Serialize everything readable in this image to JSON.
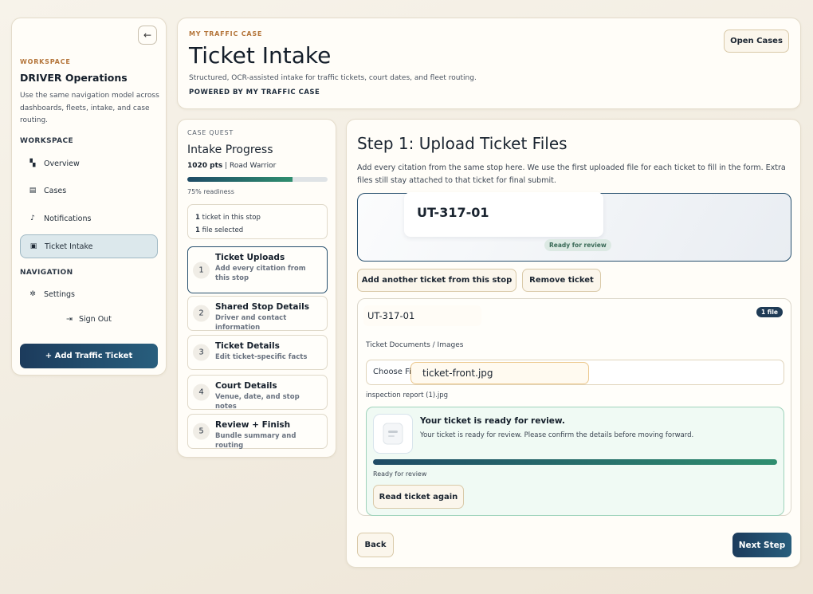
{
  "sidebar": {
    "collapse_icon": "←",
    "eyebrow": "WORKSPACE",
    "title": "DRIVER Operations",
    "description": "Use the same navigation model across dashboards, fleets, intake, and case routing.",
    "section_workspace": "WORKSPACE",
    "section_navigation": "NAVIGATION",
    "items": [
      {
        "label": "Overview",
        "icon": "dashboard-icon"
      },
      {
        "label": "Cases",
        "icon": "cases-icon"
      },
      {
        "label": "Notifications",
        "icon": "bell-icon"
      },
      {
        "label": "Ticket Intake",
        "icon": "ticket-icon",
        "active": true
      }
    ],
    "settings_label": "Settings",
    "signout_label": "Sign Out",
    "add_button": "+ Add Traffic Ticket"
  },
  "header": {
    "eyebrow": "MY TRAFFIC CASE",
    "title": "Ticket Intake",
    "subtitle": "Structured, OCR-assisted intake for traffic tickets, court dates, and fleet routing.",
    "powered": "POWERED BY MY TRAFFIC CASE",
    "open_cases": "Open Cases"
  },
  "quest": {
    "eyebrow": "CASE QUEST",
    "title": "Intake Progress",
    "points": "1020 pts",
    "rank": " | Road Warrior",
    "progress": 0.75,
    "readiness": "75% readiness",
    "stat_tickets_num": "1",
    "stat_tickets_text": " ticket in this stop",
    "stat_files_num": "1",
    "stat_files_text": " file selected",
    "steps": [
      {
        "num": "1",
        "title": "Ticket Uploads",
        "desc": "Add every citation from this stop"
      },
      {
        "num": "2",
        "title": "Shared Stop Details",
        "desc": "Driver and contact information"
      },
      {
        "num": "3",
        "title": "Ticket Details",
        "desc": "Edit ticket-specific facts"
      },
      {
        "num": "4",
        "title": "Court Details",
        "desc": "Venue, date, and stop notes"
      },
      {
        "num": "5",
        "title": "Review + Finish",
        "desc": "Bundle summary and routing"
      }
    ]
  },
  "main": {
    "title": "Step 1: Upload Ticket Files",
    "description": "Add every citation from the same stop here. We use the first uploaded file for each ticket to fill in the form. Extra files still stay attached to that ticket for final submit.",
    "ticket_tab_title": "UT-317-01",
    "ticket_tab_status": "Ready for review",
    "add_another": "Add another ticket from this stop",
    "remove_ticket": "Remove ticket",
    "doc": {
      "ticket_id": "UT-317-01",
      "file_badge": "1 file",
      "label": "Ticket Documents / Images",
      "choose_placeholder": "Choose Fi",
      "file_selected": "ticket-front.jpg",
      "file_listed": "inspection report (1).jpg"
    },
    "review": {
      "title": "Your ticket is ready for review.",
      "desc": "Your ticket is ready for review. Please confirm the details before moving forward.",
      "progress": 1.0,
      "status": "Ready for review",
      "read_again": "Read ticket again"
    },
    "back": "Back",
    "next": "Next Step"
  }
}
